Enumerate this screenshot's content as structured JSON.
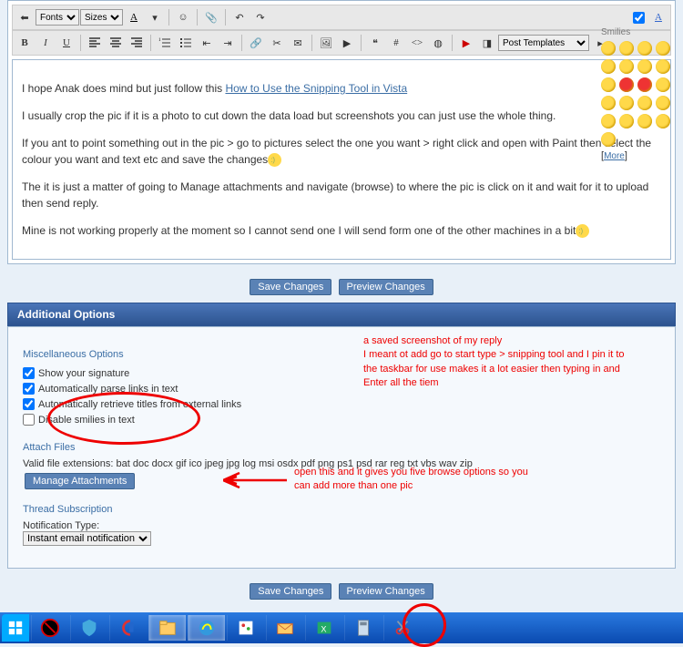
{
  "toolbar": {
    "font_dropdown": "Fonts",
    "size_dropdown": "Sizes",
    "template_dropdown": "Post Templates"
  },
  "editor_content": {
    "p1a": "I hope Anak does mind but just follow this ",
    "p1_link": "How to Use the Snipping Tool in Vista",
    "p2": "I usually crop the pic if it is a photo to cut down the data load but screenshots you can just use the whole thing.",
    "p3": "If you ant to point something out in the pic > go to pictures select the one you want > right click and open with Paint then select the colour you want and text etc and save the changes",
    "p4": "The it is just a matter of going to Manage attachments and navigate (browse) to where the pic is click on it and wait for it to upload then send reply.",
    "p5": "Mine is not working properly at the moment so I cannot send one I will send form one of the other machines in a bit"
  },
  "smilies_title": "Smilies",
  "smilies_more": "More",
  "buttons": {
    "save": "Save Changes",
    "preview": "Preview Changes",
    "manage_attachments": "Manage Attachments"
  },
  "sections": {
    "additional_options": "Additional Options",
    "misc": "Miscellaneous Options",
    "attach": "Attach Files",
    "thread_sub": "Thread Subscription"
  },
  "options": {
    "show_sig": {
      "label": "Show your signature",
      "checked": true
    },
    "auto_parse": {
      "label": "Automatically parse links in text",
      "checked": true
    },
    "auto_titles": {
      "label": "Automatically retrieve titles from external links",
      "checked": true
    },
    "disable_smilies": {
      "label": "Disable smilies in text",
      "checked": false
    }
  },
  "attach_info": "Valid file extensions: bat doc docx gif ico jpeg jpg log msi osdx pdf png ps1 psd rar reg txt vbs wav zip",
  "notification": {
    "label": "Notification Type:",
    "value": "Instant email notification"
  },
  "annotations": {
    "a1": "a saved screenshot of my reply\nI meant ot add go to start type > snipping tool and I pin  it to the taskbar for use makes it a lot easier then typing in and Enter all the tiem",
    "a2": "open this and it gives you five browse options so you can add more than one pic"
  }
}
